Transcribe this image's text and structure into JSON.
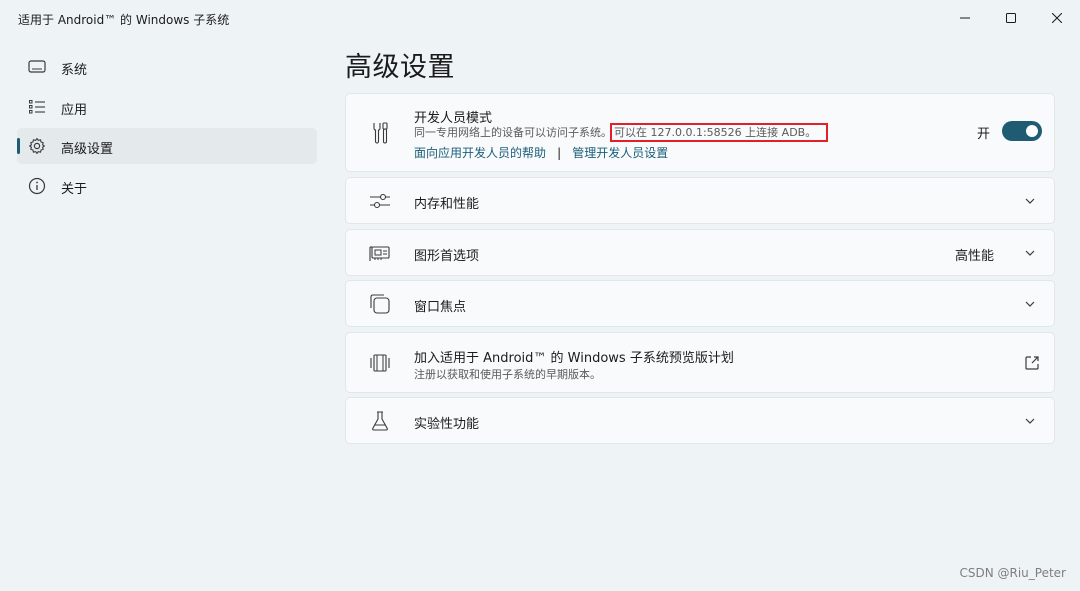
{
  "window": {
    "title": "适用于 Android™ 的 Windows 子系统"
  },
  "sidebar": {
    "items": [
      {
        "label": "系统",
        "icon": "monitor-icon",
        "active": false
      },
      {
        "label": "应用",
        "icon": "list-icon",
        "active": false
      },
      {
        "label": "高级设置",
        "icon": "gear-icon",
        "active": true
      },
      {
        "label": "关于",
        "icon": "info-icon",
        "active": false
      }
    ]
  },
  "main": {
    "page_title": "高级设置",
    "developer_mode": {
      "title": "开发人员模式",
      "description": "同一专用网络上的设备可以访问子系统。",
      "adb_text": "可以在 127.0.0.1:58526 上连接 ADB。",
      "help_link": "面向应用开发人员的帮助",
      "separator": "|",
      "manage_link": "管理开发人员设置",
      "toggle_label": "开",
      "toggle_on": true
    },
    "memory": {
      "title": "内存和性能"
    },
    "graphics": {
      "title": "图形首选项",
      "value": "高性能"
    },
    "window_focus": {
      "title": "窗口焦点"
    },
    "preview": {
      "title": "加入适用于 Android™ 的 Windows 子系统预览版计划",
      "description": "注册以获取和使用子系统的早期版本。"
    },
    "experimental": {
      "title": "实验性功能"
    }
  },
  "watermark": "CSDN @Riu_Peter",
  "colors": {
    "accent": "#1f5c73",
    "highlight_box": "#e0202b",
    "link": "#1b5e7a"
  }
}
